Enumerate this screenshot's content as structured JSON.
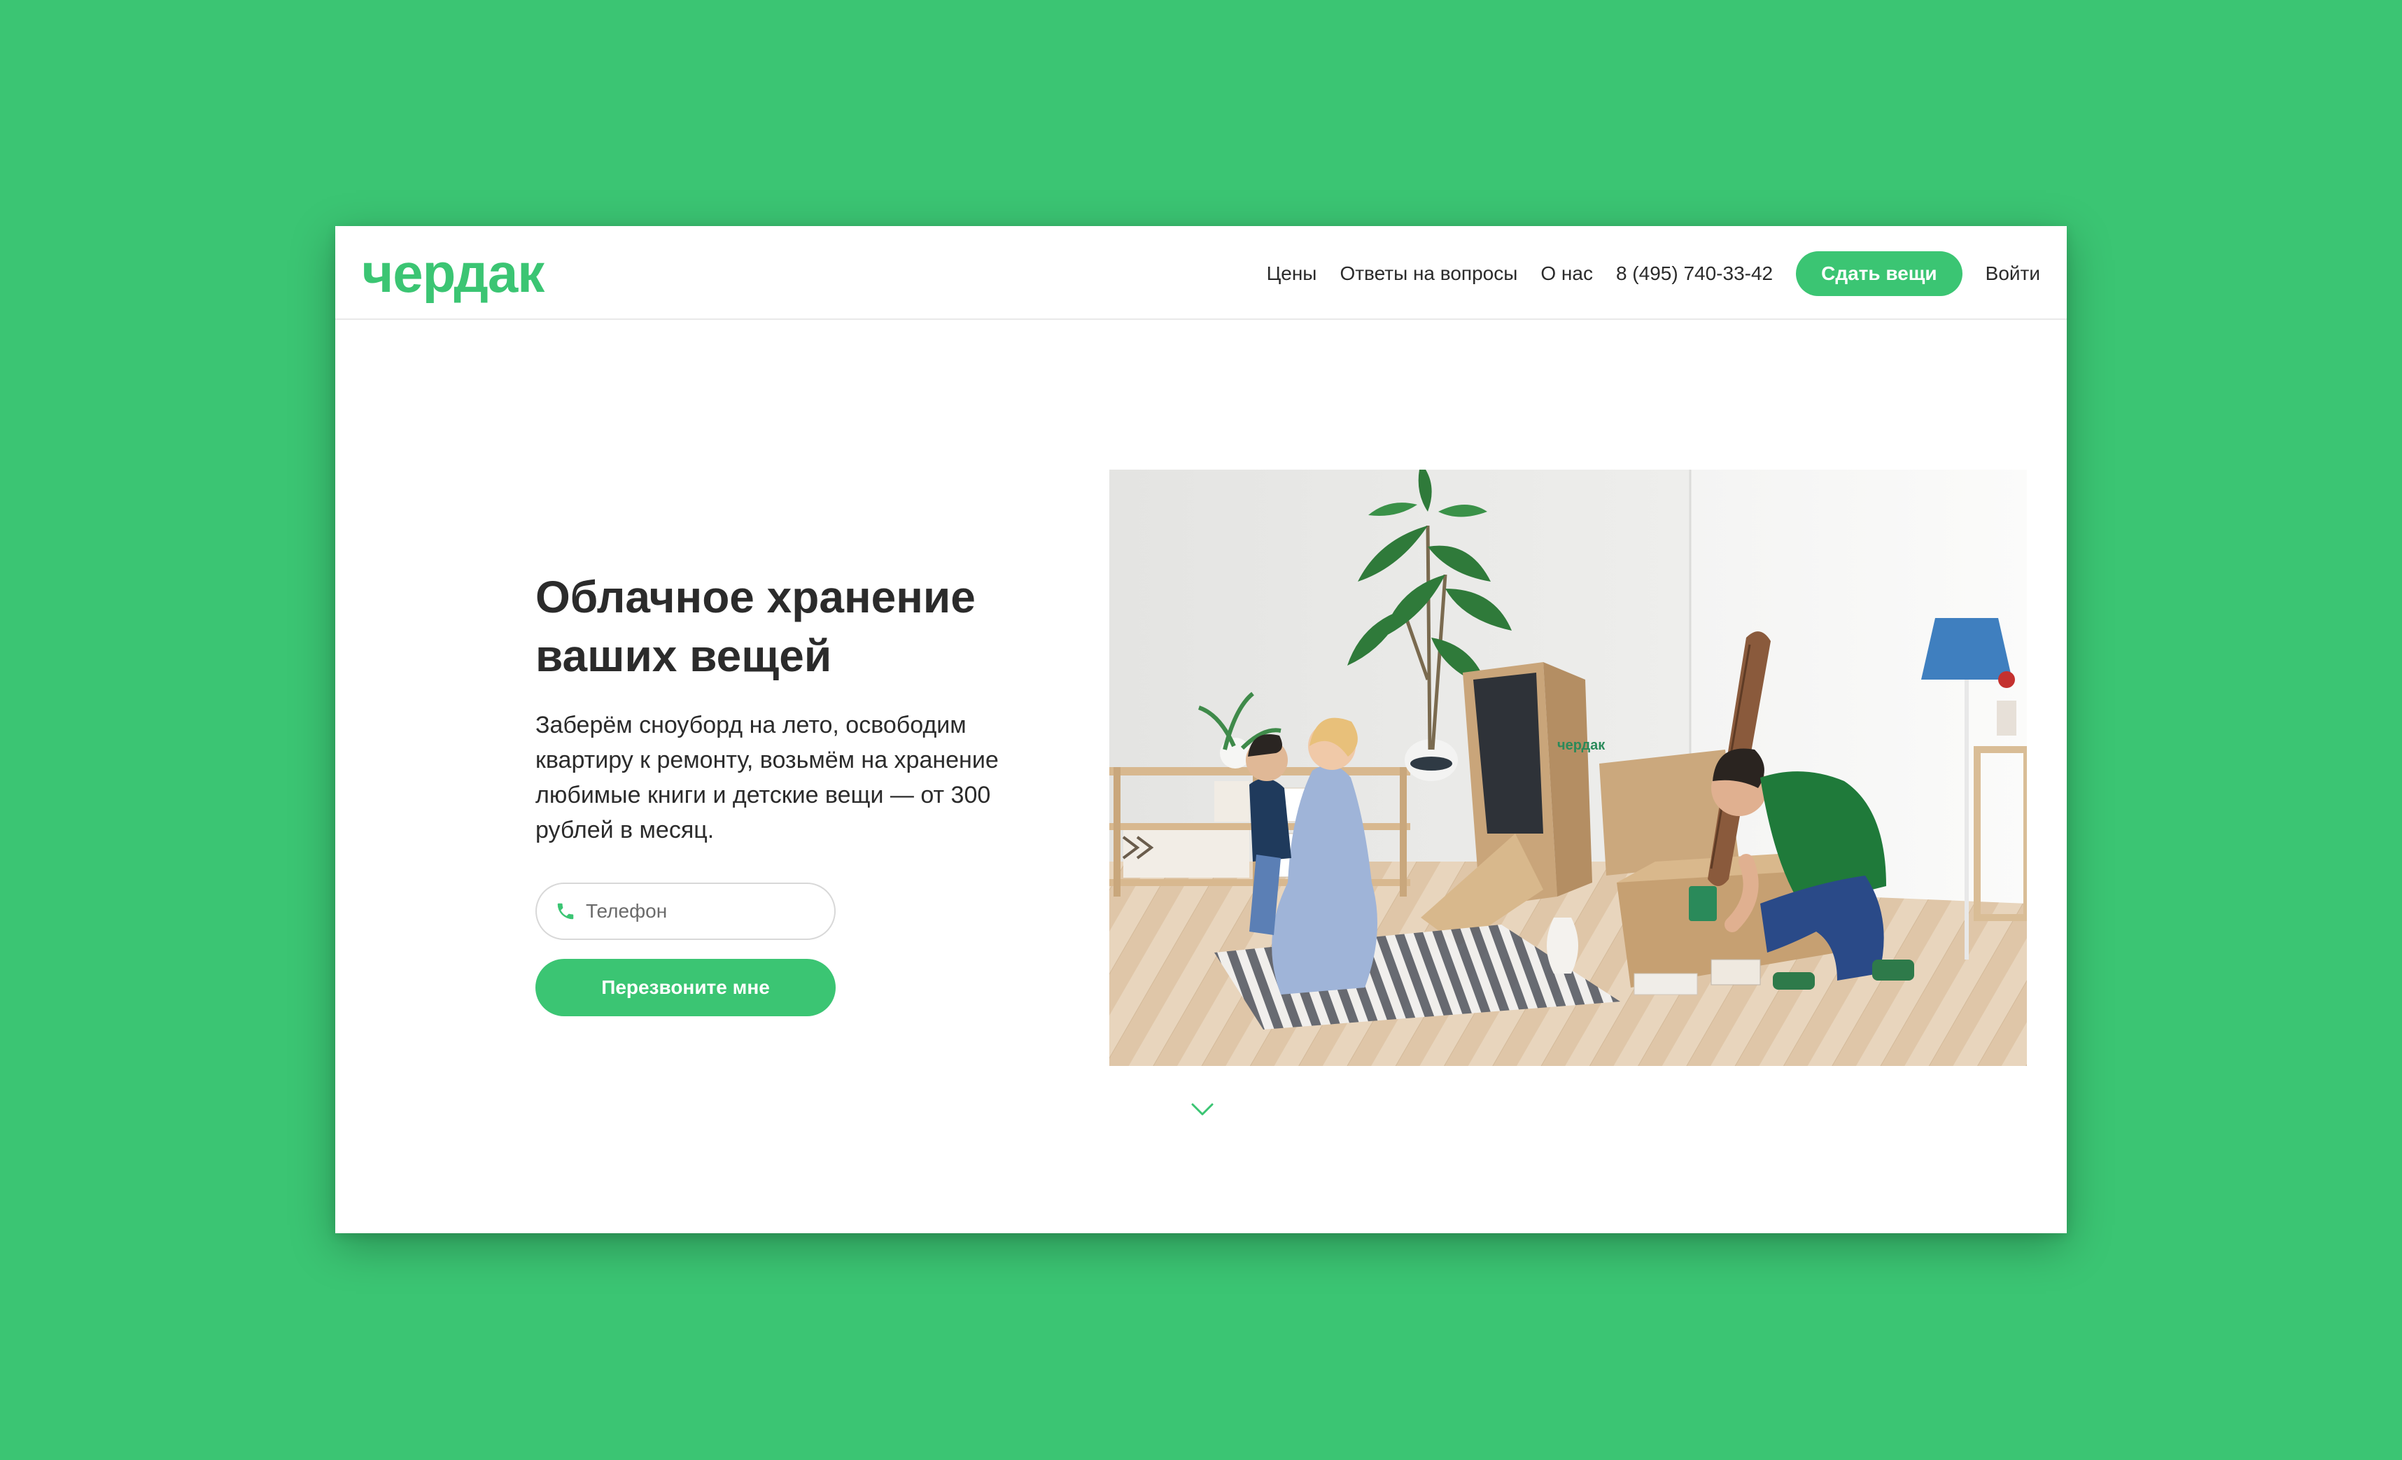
{
  "app": {
    "logo_text": "чердак",
    "brand_color": "#3bc573"
  },
  "header": {
    "nav": [
      {
        "label": "Цены"
      },
      {
        "label": "Ответы на вопросы"
      },
      {
        "label": "О нас"
      },
      {
        "label": "8 (495) 740-33-42"
      }
    ],
    "cta_label": "Сдать вещи",
    "login_label": "Войти"
  },
  "hero": {
    "title": "Облачное хранение ваших вещей",
    "text": "Заберём сноуборд на лето, освободим квартиру к ремонту, возьмём на хранение любимые книги и детские вещи — от 300 рублей в месяц.",
    "phone_placeholder": "Телефон",
    "phone_icon": "phone-icon",
    "submit_label": "Перезвоните мне",
    "image_box_label": "чердак",
    "scroll_icon": "chevron-down-icon"
  }
}
